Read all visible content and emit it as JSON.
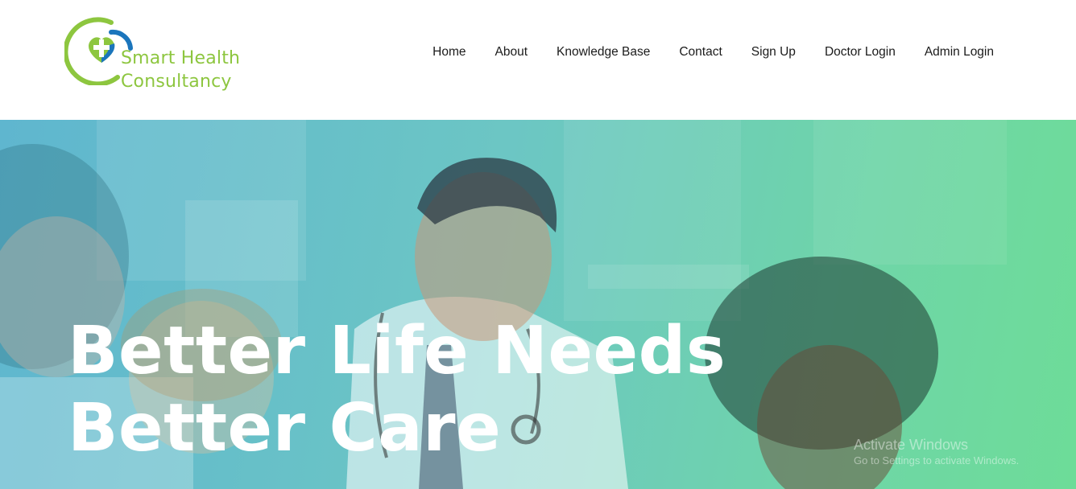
{
  "brand": {
    "line1": "Smart Health",
    "line2": "Consultancy",
    "logo_colors": {
      "green": "#8dc63f",
      "blue": "#1b75bc"
    }
  },
  "nav": {
    "items": [
      {
        "label": "Home"
      },
      {
        "label": "About"
      },
      {
        "label": "Knowledge Base"
      },
      {
        "label": "Contact"
      },
      {
        "label": "Sign Up"
      },
      {
        "label": "Doctor Login"
      },
      {
        "label": "Admin Login"
      }
    ]
  },
  "hero": {
    "title_line1": "Better Life Needs",
    "title_line2": "Better Care",
    "gradient": {
      "start": "#5fb6cf",
      "end": "#6ddc98"
    }
  },
  "watermark": {
    "title": "Activate Windows",
    "subtitle": "Go to Settings to activate Windows."
  }
}
